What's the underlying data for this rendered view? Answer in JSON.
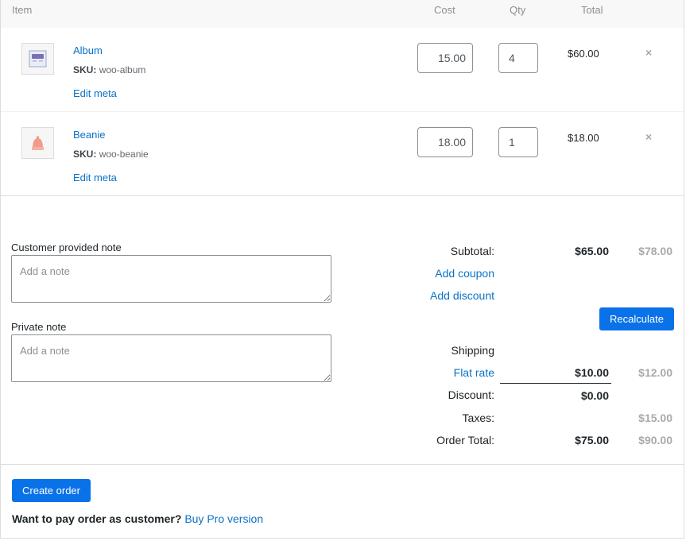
{
  "table": {
    "headers": {
      "item": "Item",
      "cost": "Cost",
      "qty": "Qty",
      "total": "Total"
    }
  },
  "items": [
    {
      "name": "Album",
      "sku_label": "SKU:",
      "sku": "woo-album",
      "edit_meta": "Edit meta",
      "cost": "15.00",
      "qty": "4",
      "total": "$60.00",
      "remove": "×"
    },
    {
      "name": "Beanie",
      "sku_label": "SKU:",
      "sku": "woo-beanie",
      "edit_meta": "Edit meta",
      "cost": "18.00",
      "qty": "1",
      "total": "$18.00",
      "remove": "×"
    }
  ],
  "notes": {
    "customer_label": "Customer provided note",
    "customer_placeholder": "Add a note",
    "private_label": "Private note",
    "private_placeholder": "Add a note"
  },
  "totals": {
    "subtotal_label": "Subtotal:",
    "subtotal": "$65.00",
    "subtotal_orig": "$78.00",
    "add_coupon": "Add coupon",
    "add_discount": "Add discount",
    "recalculate": "Recalculate",
    "shipping_label": "Shipping",
    "flat_rate": "Flat rate",
    "shipping": "$10.00",
    "shipping_orig": "$12.00",
    "discount_label": "Discount:",
    "discount": "$0.00",
    "taxes_label": "Taxes:",
    "taxes_orig": "$15.00",
    "order_total_label": "Order Total:",
    "order_total": "$75.00",
    "order_total_orig": "$90.00"
  },
  "footer": {
    "create_order": "Create order",
    "pay_question": "Want to pay order as customer?",
    "buy_pro": "Buy Pro version"
  },
  "colors": {
    "accent": "#0a72e8",
    "link": "#0a72c7",
    "muted": "#a7aaad"
  }
}
